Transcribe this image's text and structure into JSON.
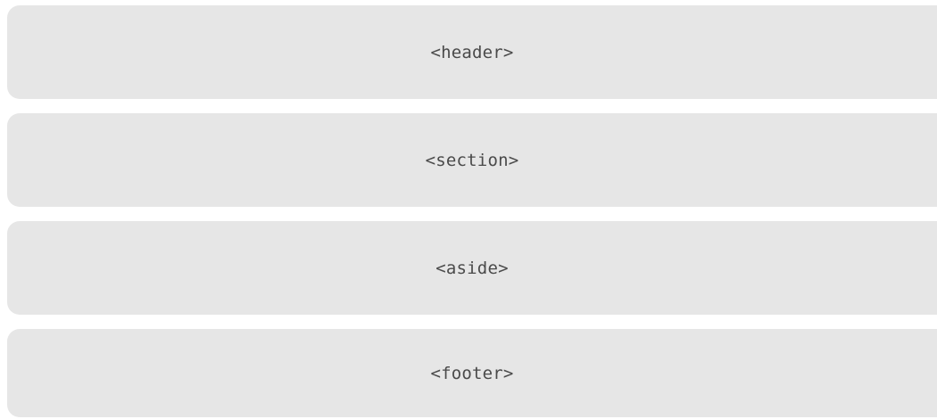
{
  "blocks": [
    {
      "label": "<header>"
    },
    {
      "label": "<section>"
    },
    {
      "label": "<aside>"
    },
    {
      "label": "<footer>"
    }
  ],
  "colors": {
    "block_background": "#e6e6e6",
    "label_text": "#4a4a4a",
    "page_background": "#ffffff"
  }
}
